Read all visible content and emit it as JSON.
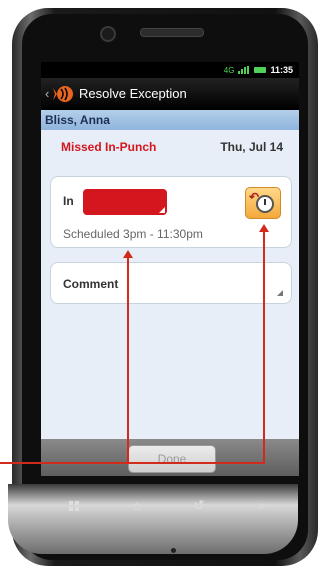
{
  "status_bar": {
    "time": "11:35",
    "network_label": "4G"
  },
  "action_bar": {
    "back_glyph": "‹",
    "title": "Resolve Exception"
  },
  "employee": {
    "name": "Bliss, Anna"
  },
  "exception": {
    "type": "Missed In-Punch",
    "date": "Thu, Jul 14"
  },
  "punch_card": {
    "in_label": "In",
    "scheduled_text": "Scheduled 3pm - 11:30pm"
  },
  "comment_card": {
    "label": "Comment"
  },
  "footer": {
    "done_label": "Done"
  },
  "colors": {
    "error_red": "#d4161e",
    "clock_button": "#f3a93a",
    "annotation": "#d42a1c"
  },
  "icons": [
    "app-logo-icon",
    "clock-icon",
    "home-icon",
    "back-icon",
    "search-icon",
    "menu-grid-icon"
  ]
}
